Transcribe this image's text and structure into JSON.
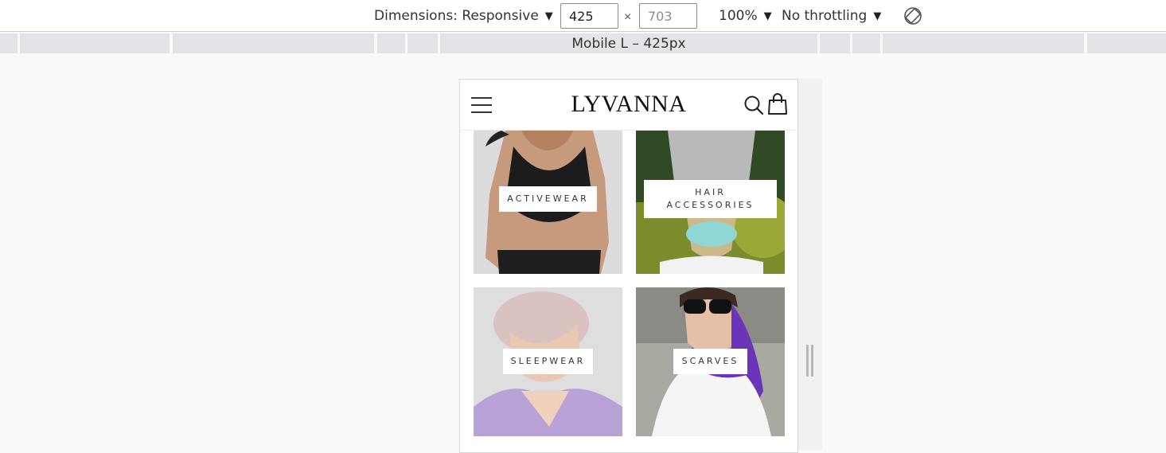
{
  "toolbar": {
    "dimensions_label": "Dimensions: Responsive",
    "width_value": "425",
    "height_placeholder": "703",
    "times_symbol": "×",
    "zoom_label": "100%",
    "throttling_label": "No throttling",
    "caret_icon": "▼",
    "rotate_icon": "rotate-device-icon"
  },
  "media_bar": {
    "active_label": "Mobile L – 425px"
  },
  "site": {
    "logo": "LYVANNA",
    "icons": [
      "hamburger-menu-icon",
      "search-icon",
      "shopping-bag-icon"
    ],
    "categories": [
      {
        "label": "ACTIVEWEAR"
      },
      {
        "label_line1": "HAIR",
        "label_line2": "ACCESSORIES"
      },
      {
        "label": "SLEEPWEAR"
      },
      {
        "label": "SCARVES"
      }
    ]
  },
  "colors": {
    "toolbar_bg": "#ffffff",
    "media_segment": "#e2e4e7",
    "page_bg": "#f9f9f9",
    "sleepwear_lilac": "#b9a3d6",
    "scarf_purple": "#6a35b8"
  }
}
